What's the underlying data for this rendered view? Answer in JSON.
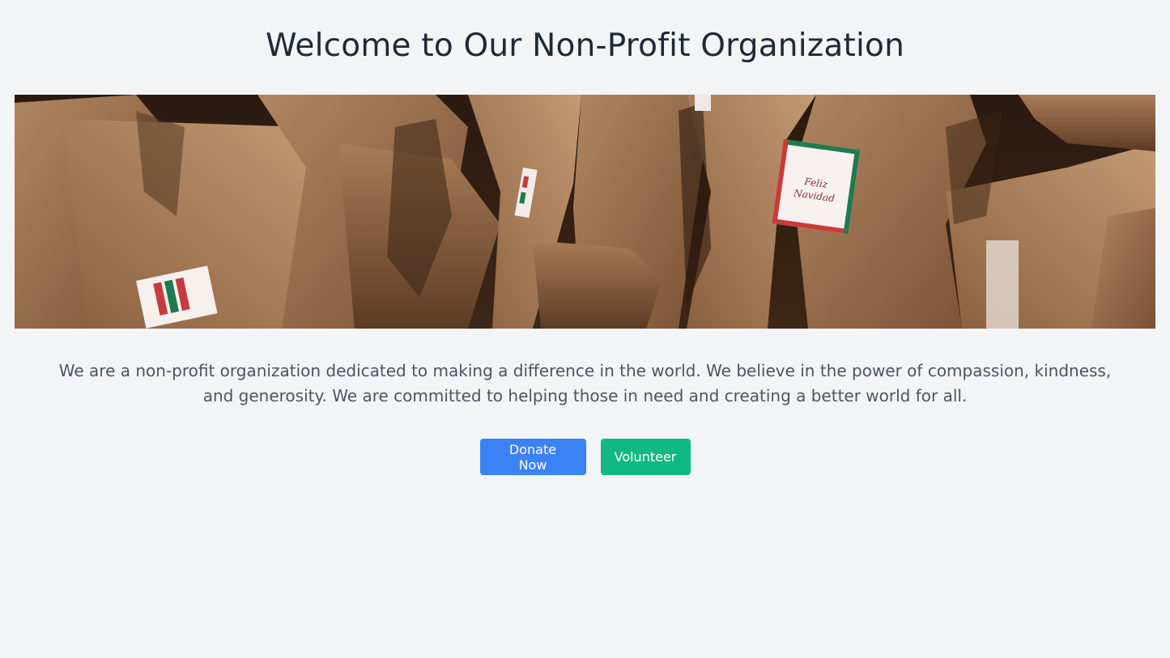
{
  "page": {
    "title": "Welcome to Our Non-Profit Organization",
    "description": "We are a non-profit organization dedicated to making a difference in the world. We believe in the power of compassion, kindness, and generosity. We are committed to helping those in need and creating a better world for all."
  },
  "hero": {
    "tag_text_line1": "Feliz",
    "tag_text_line2": "Navidad"
  },
  "actions": {
    "donate_label": "Donate Now",
    "volunteer_label": "Volunteer"
  },
  "colors": {
    "background": "#f3f4f6",
    "title": "#1f2937",
    "body_text": "#4b5563",
    "donate_button": "#3b82f6",
    "volunteer_button": "#10b981"
  }
}
